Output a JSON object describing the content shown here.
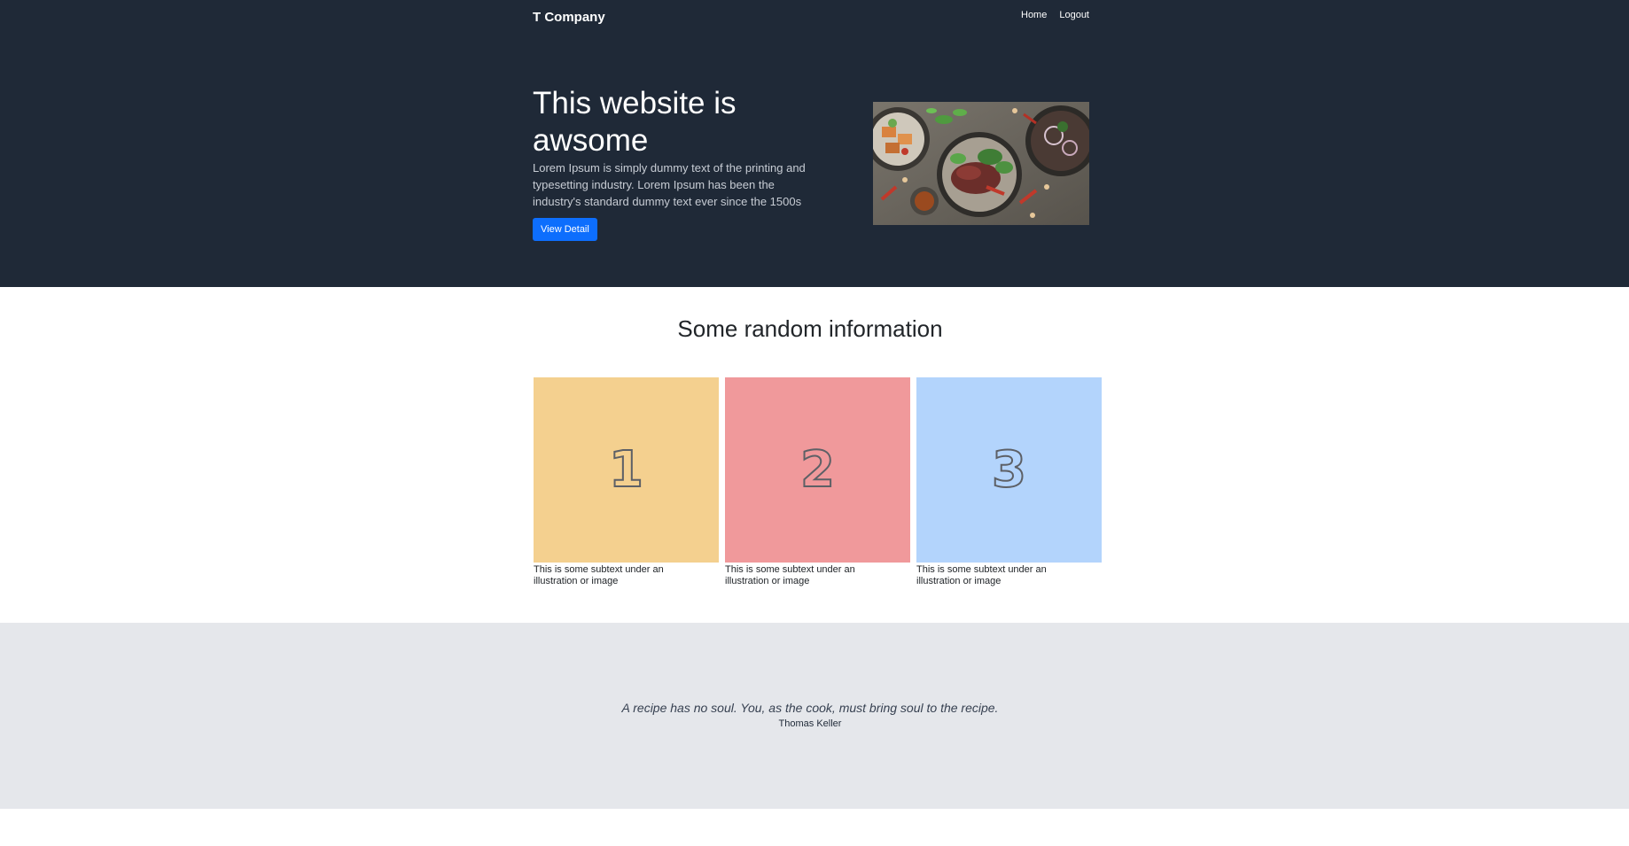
{
  "header": {
    "brand": "T Company",
    "nav": [
      "Home",
      "Logout"
    ]
  },
  "hero": {
    "title": "This website is awsome",
    "description": "Lorem Ipsum is simply dummy text of the printing and typesetting industry. Lorem Ipsum has been the industry's standard dummy text ever since the 1500s",
    "button_label": "View Detail"
  },
  "features": {
    "title": "Some random information",
    "cards": [
      {
        "number": "1",
        "caption": "This is some subtext under an illustration or image",
        "color": "#f4d08f"
      },
      {
        "number": "2",
        "caption": "This is some subtext under an illustration or image",
        "color": "#f0999b"
      },
      {
        "number": "3",
        "caption": "This is some subtext under an illustration or image",
        "color": "#b3d4fc"
      }
    ]
  },
  "quote": {
    "text": "A recipe has no soul. You, as the cook, must bring soul to the recipe.",
    "author": "Thomas Keller"
  },
  "colors": {
    "header_bg": "#1f2937",
    "primary": "#0d6efd",
    "quote_bg": "#e5e7eb"
  }
}
